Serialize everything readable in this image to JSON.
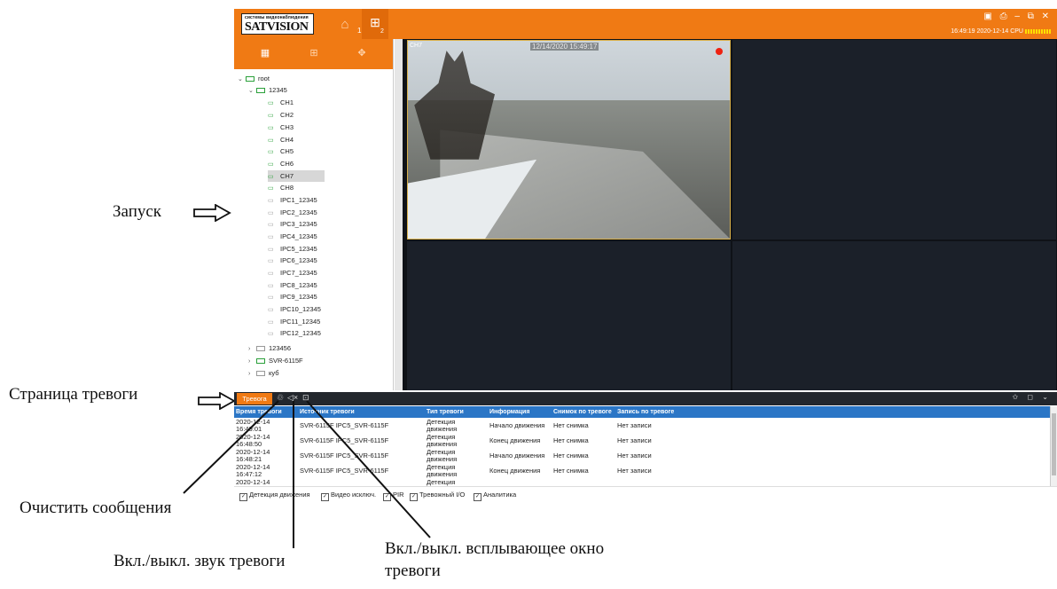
{
  "topbar": {
    "logo_sub": "системы видеонаблюдения",
    "logo_main": "SATVISION",
    "home_icon": "home-icon",
    "layout_icon": "grid-icon",
    "tab_index_1": "1",
    "tab_index_2": "2",
    "window_controls": "▣ ⎙ – ▭ ✕",
    "status_time": "16:49:19 2020-12-14 CPU",
    "accent": "#f07a14"
  },
  "sidebar": {
    "tabs": [
      "device-list-icon",
      "layout-icon",
      "ptz-icon"
    ],
    "tree": {
      "root": "root",
      "group1": "12345",
      "channels": [
        "CH1",
        "CH2",
        "CH3",
        "CH4",
        "CH5",
        "CH6",
        "CH7",
        "CH8"
      ],
      "ipc": [
        "IPC1_12345",
        "IPC2_12345",
        "IPC3_12345",
        "IPC4_12345",
        "IPC5_12345",
        "IPC6_12345",
        "IPC7_12345",
        "IPC8_12345",
        "IPC9_12345",
        "IPC10_12345",
        "IPC11_12345",
        "IPC12_12345"
      ],
      "other_devices": [
        "123456",
        "SVR-6115F",
        "куб"
      ]
    }
  },
  "video": {
    "active_label": "CH7",
    "timestamp": "12/14/2020 15:49:17"
  },
  "alarm": {
    "tab_label": "Тревога",
    "columns": [
      "Время тревоги",
      "Источник тревоги",
      "Тип тревоги",
      "Информация",
      "Снимок по тревоге",
      "Запись по тревоге"
    ],
    "rows": [
      {
        "time1": "2020-12-14",
        "time2": "16:49:01",
        "source": "SVR-6115F IPC5_SVR-6115F",
        "type1": "Детекция",
        "type2": "движения",
        "info": "Начало движения",
        "snap": "Нет снимка",
        "rec": "Нет записи"
      },
      {
        "time1": "2020-12-14",
        "time2": "16:48:50",
        "source": "SVR-6115F IPC5_SVR-6115F",
        "type1": "Детекция",
        "type2": "движения",
        "info": "Конец движения",
        "snap": "Нет снимка",
        "rec": "Нет записи"
      },
      {
        "time1": "2020-12-14",
        "time2": "16:48:21",
        "source": "SVR-6115F IPC5_SVR-6115F",
        "type1": "Детекция",
        "type2": "движения",
        "info": "Начало движения",
        "snap": "Нет снимка",
        "rec": "Нет записи"
      },
      {
        "time1": "2020-12-14",
        "time2": "16:47:12",
        "source": "SVR-6115F IPC5_SVR-6115F",
        "type1": "Детекция",
        "type2": "движения",
        "info": "Конец движения",
        "snap": "Нет снимка",
        "rec": "Нет записи"
      },
      {
        "time1": "2020-12-14",
        "time2": "",
        "source": "",
        "type1": "Детекция",
        "type2": "",
        "info": "",
        "snap": "",
        "rec": ""
      }
    ],
    "filters": [
      "Детекция движения",
      "Видео исключ.",
      "PIR",
      "Тревожный I/O",
      "Аналитика"
    ]
  },
  "annotations": {
    "launch": "Запуск",
    "alarm_page": "Страница тревоги",
    "clear_messages": "Очистить сообщения",
    "sound_toggle": "Вкл./выкл. звук тревоги",
    "popup_toggle_1": "Вкл./выкл. всплывающее окно",
    "popup_toggle_2": "тревоги"
  }
}
